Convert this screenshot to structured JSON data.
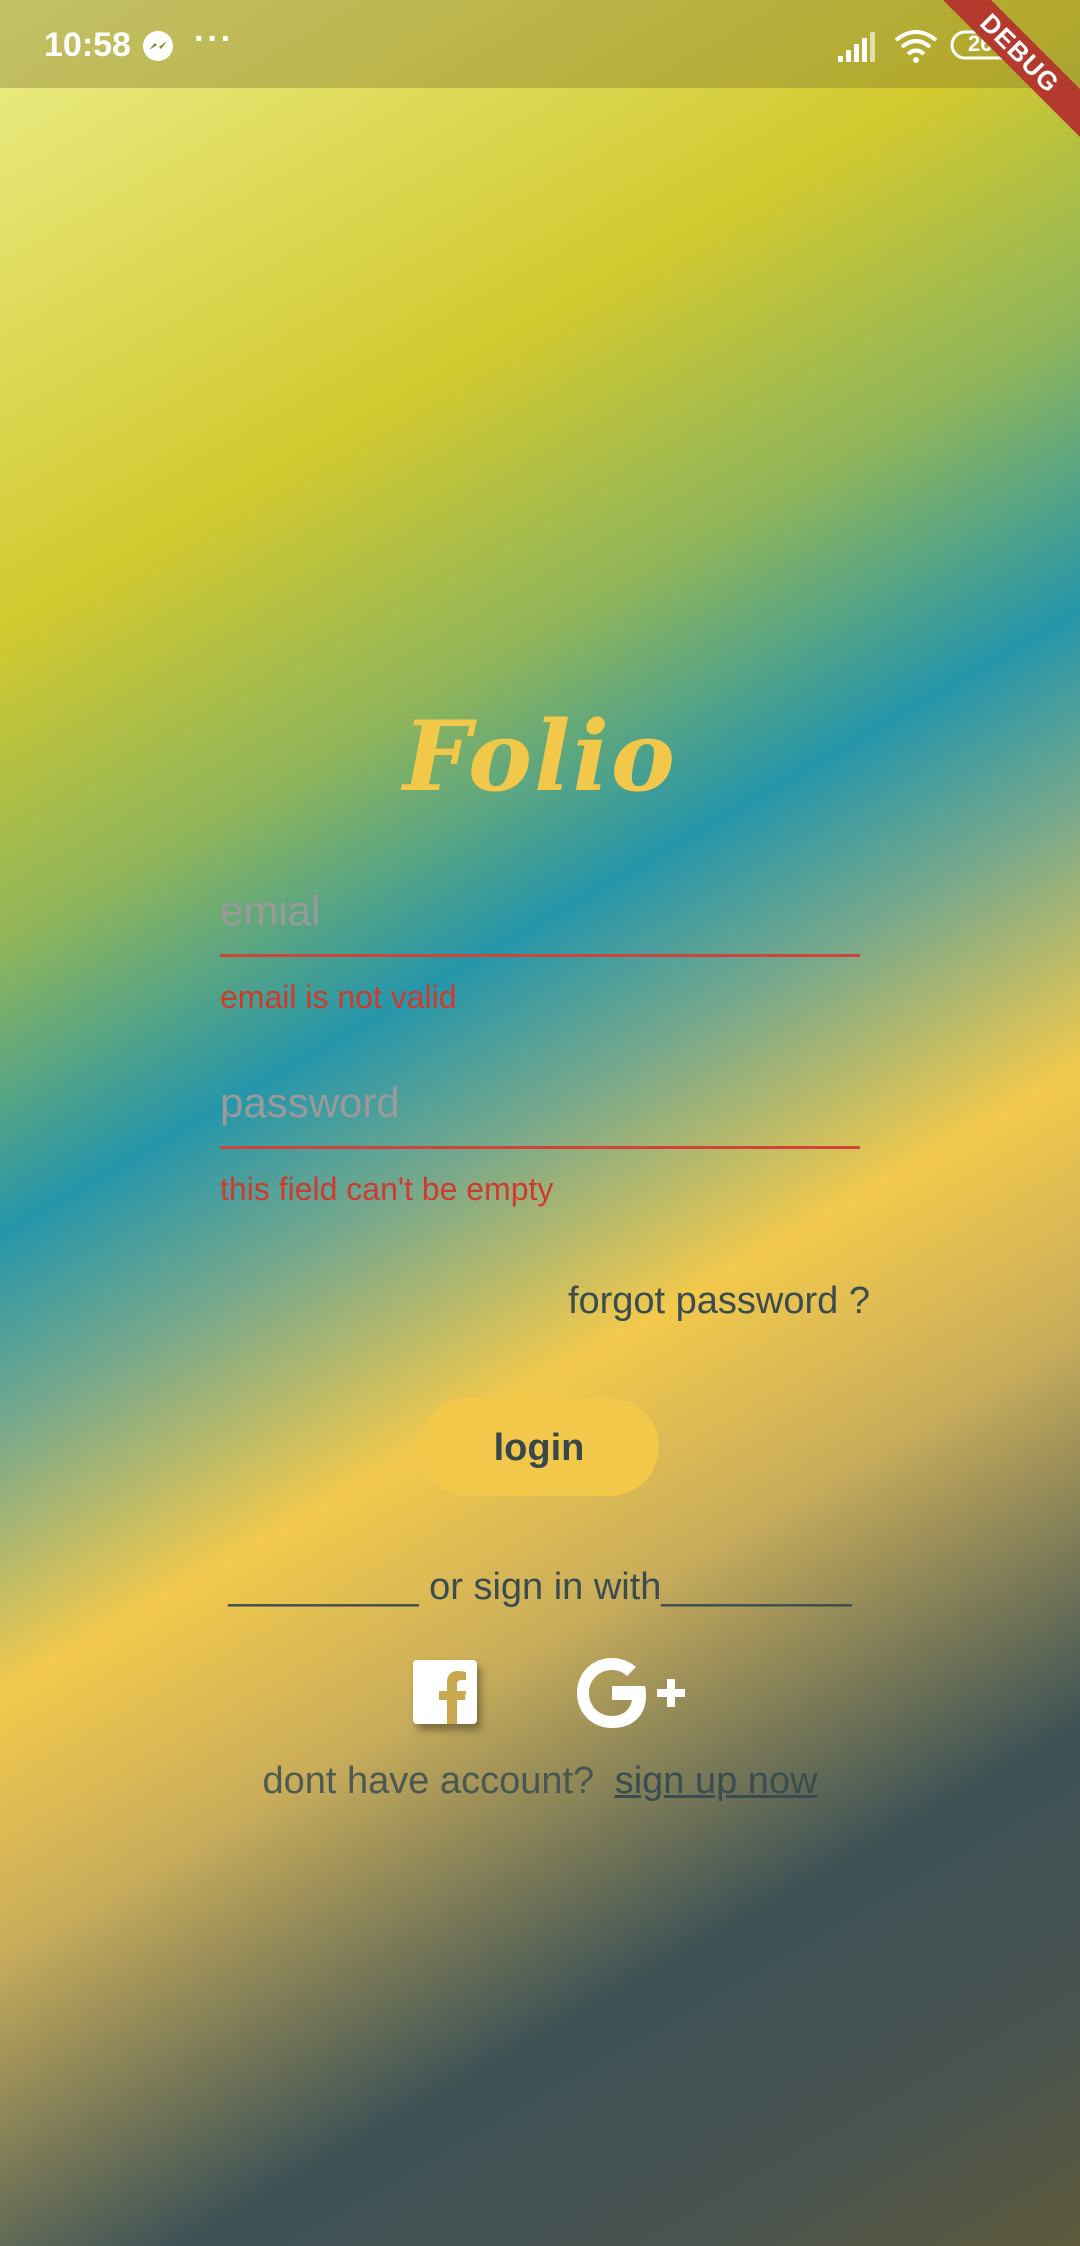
{
  "status_bar": {
    "time": "10:58",
    "more": "···",
    "battery": "26",
    "icons": [
      "messenger-icon",
      "signal-icon",
      "wifi-icon",
      "battery-icon"
    ]
  },
  "debug_banner": "DEBUG",
  "app": {
    "logo": "Folio",
    "email": {
      "placeholder": "emial",
      "value": "",
      "error": "email is not valid"
    },
    "password": {
      "placeholder": "password",
      "value": "",
      "error": "this field can't be empty"
    },
    "forgot_password": "forgot password ?",
    "login_label": "login",
    "divider": "_________ or sign in with_________",
    "social": [
      "facebook-icon",
      "google-plus-icon"
    ],
    "signup_prompt": "dont have account?",
    "signup_link": "sign up now"
  },
  "colors": {
    "accent": "#f2c84b",
    "error": "#d03a2c",
    "text": "#3b4c50",
    "debug": "#b53a2e"
  }
}
